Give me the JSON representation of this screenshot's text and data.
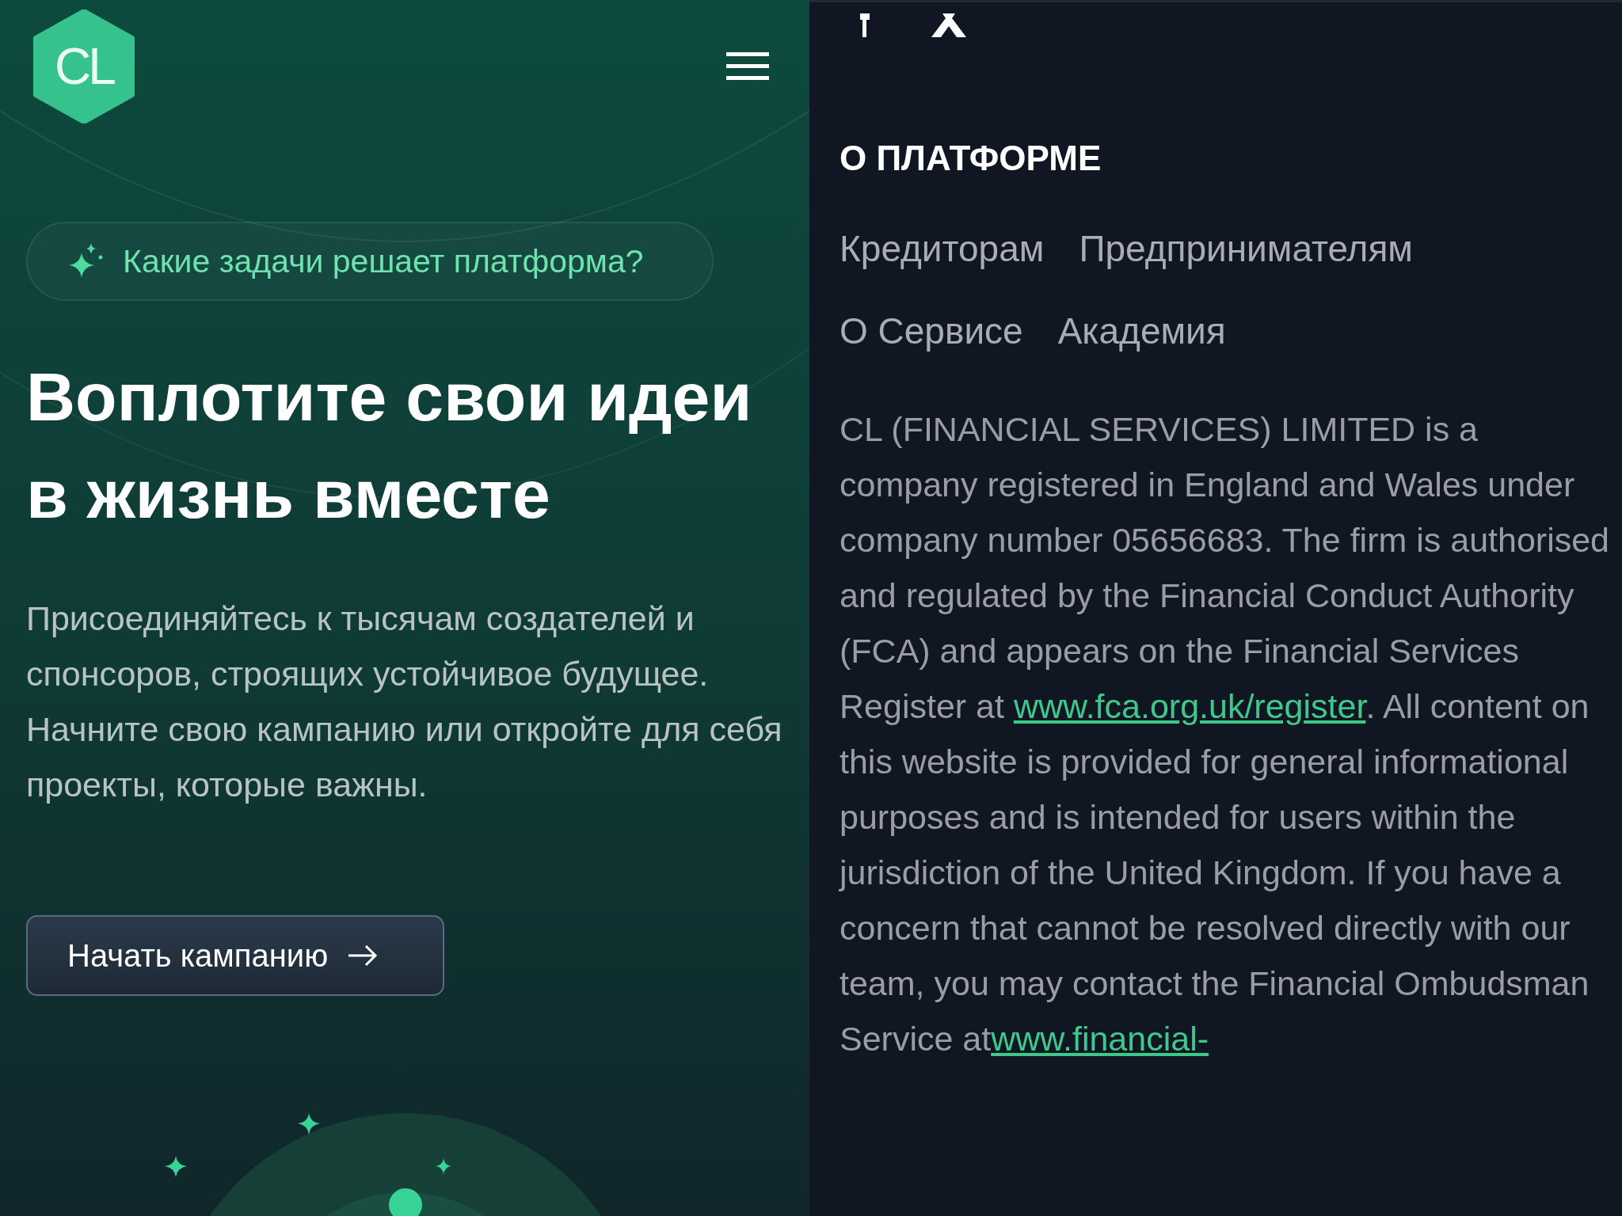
{
  "logo": {
    "text": "CL"
  },
  "badge": {
    "text": "Какие задачи решает платформа?"
  },
  "hero": {
    "title_lines": [
      "Воплотите свои идеи",
      "в жизнь вместе"
    ],
    "description": "Присоединяйтесь к тысячам создателей и спонсоров, строящих устойчивое будущее. Начните свою кампанию или откройте для себя проекты, которые важны."
  },
  "cta": {
    "label": "Начать кампанию"
  },
  "footer": {
    "section_title": "О ПЛАТФОРМЕ",
    "nav_rows": [
      [
        "Кредиторам",
        "Предпринимателям"
      ],
      [
        "О Сервисе",
        "Академия"
      ]
    ],
    "legal": [
      {
        "kind": "text",
        "text": "CL (FINANCIAL SERVICES) LIMITED is a company registered in England and Wales under company number 05656683. The firm is authorised and regulated by the Financial Conduct Authority (FCA) and appears on the Financial Services Register at "
      },
      {
        "kind": "link",
        "text": "www.fca.org.uk/register"
      },
      {
        "kind": "text",
        "text": ". All content on this website is provided for general informational purposes and is intended for users within the jurisdiction of the United Kingdom. If you have a concern that cannot be resolved directly with our team, you may contact the Financial Ombudsman Service at"
      },
      {
        "kind": "link",
        "text": "www.financial-"
      }
    ]
  }
}
